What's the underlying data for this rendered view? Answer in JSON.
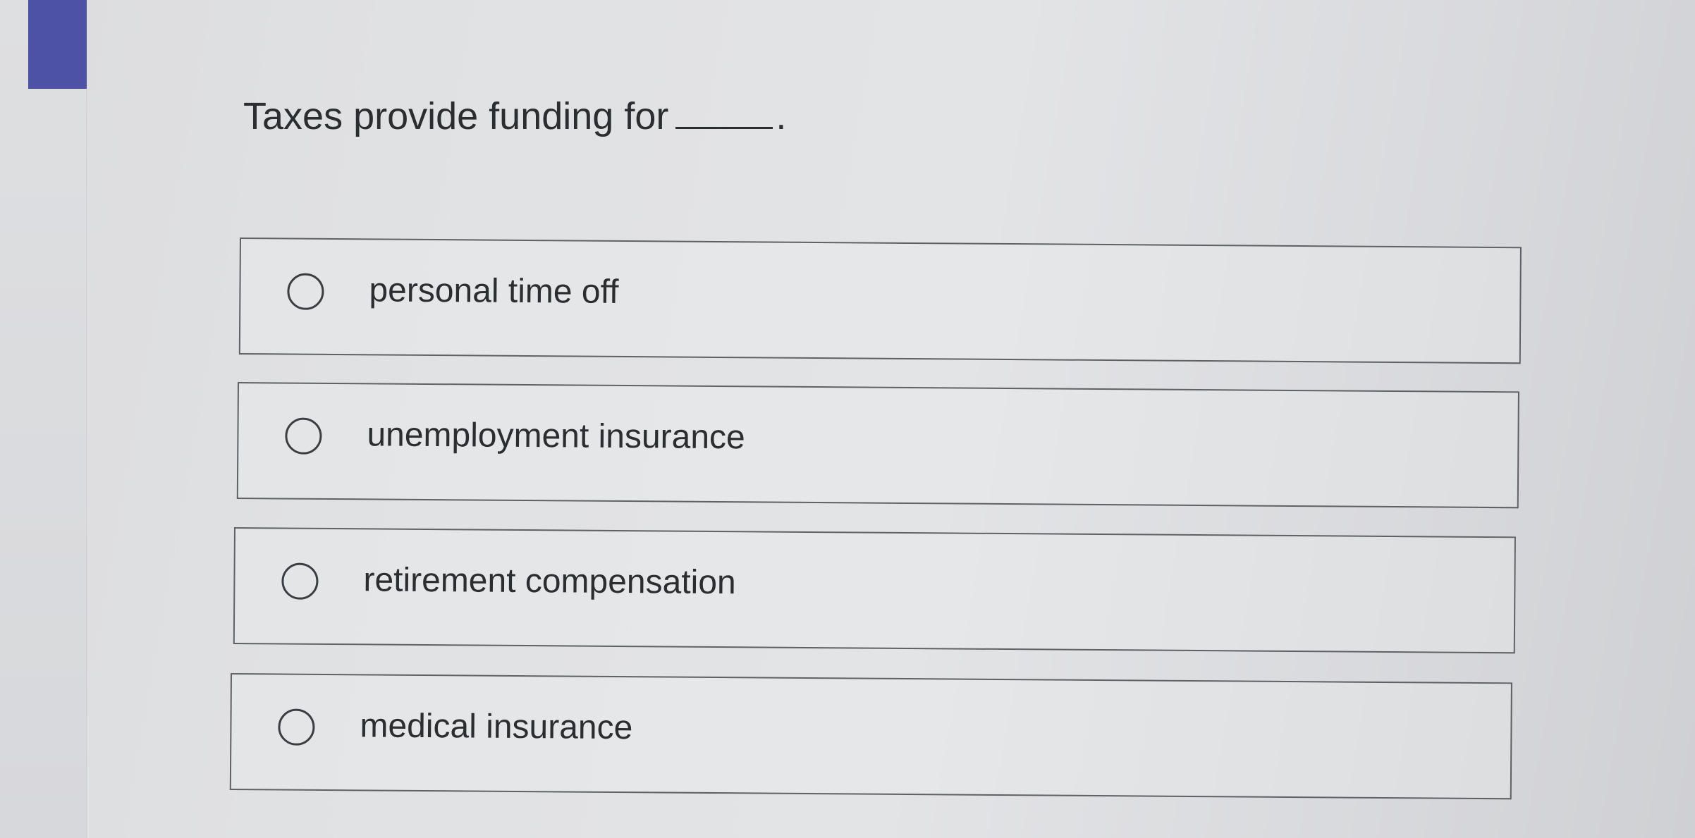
{
  "question": {
    "text": "Taxes provide funding for",
    "trailing": "."
  },
  "options": [
    {
      "label": "personal time off",
      "selected": false
    },
    {
      "label": "unemployment insurance",
      "selected": false
    },
    {
      "label": "retirement compensation",
      "selected": false
    },
    {
      "label": "medical insurance",
      "selected": false
    }
  ],
  "colors": {
    "accent": "#4e52a6",
    "border": "#5e6165",
    "text": "#2b2e31"
  }
}
